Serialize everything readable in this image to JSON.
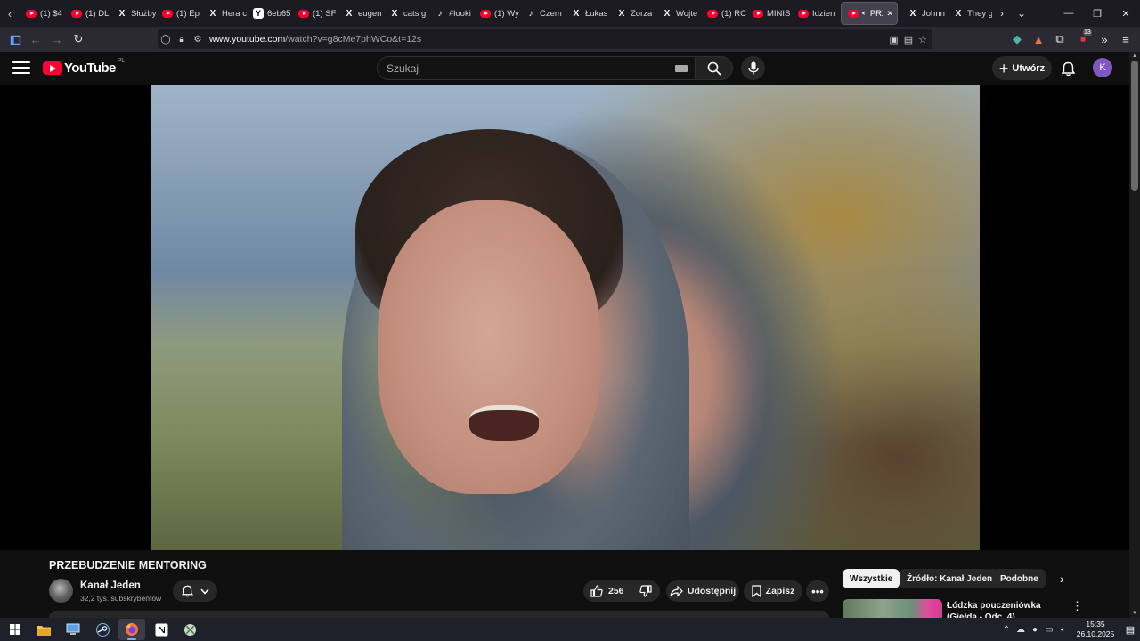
{
  "browser": {
    "tabs": [
      {
        "icon": "youtube-icon",
        "title": "(1) $4"
      },
      {
        "icon": "youtube-icon",
        "title": "(1) DL"
      },
      {
        "icon": "x-icon",
        "title": "Służby"
      },
      {
        "icon": "youtube-icon",
        "title": "(1) Ep"
      },
      {
        "icon": "x-icon",
        "title": "Hera c"
      },
      {
        "icon": "y-icon",
        "title": "6eb65"
      },
      {
        "icon": "youtube-icon",
        "title": "(1) SF"
      },
      {
        "icon": "x-icon",
        "title": "eugen"
      },
      {
        "icon": "x-icon",
        "title": "cats g"
      },
      {
        "icon": "tiktok-icon",
        "title": "#looki"
      },
      {
        "icon": "youtube-icon",
        "title": "(1) Wy"
      },
      {
        "icon": "tiktok-icon",
        "title": "Czem"
      },
      {
        "icon": "x-icon",
        "title": "Łukas"
      },
      {
        "icon": "x-icon",
        "title": "Zorza"
      },
      {
        "icon": "x-icon",
        "title": "Wojte"
      },
      {
        "icon": "youtube-icon",
        "title": "(1) RC"
      },
      {
        "icon": "youtube-icon",
        "title": "MINIS"
      },
      {
        "icon": "youtube-icon",
        "title": "Idzien"
      },
      {
        "icon": "youtube-icon",
        "title": "PRZ",
        "active": true
      },
      {
        "icon": "x-icon",
        "title": "Johnn"
      },
      {
        "icon": "x-icon",
        "title": "They g"
      }
    ],
    "url_host": "www.youtube.com",
    "url_path": "/watch?v=g8cMe7phWCo&t=12s",
    "extension_badge": "13"
  },
  "masthead": {
    "logo_text": "YouTube",
    "country_code": "PL",
    "search_placeholder": "Szukaj",
    "create_label": "Utwórz",
    "avatar_letter": "K"
  },
  "video": {
    "title": "PRZEBUDZENIE MENTORING",
    "channel_name": "Kanał Jeden",
    "subscribers": "32,2 tys. subskrybentów",
    "likes": "256",
    "share_label": "Udostępnij",
    "save_label": "Zapisz"
  },
  "sidebar": {
    "chips": [
      "Wszystkie",
      "Źródło: Kanał Jeden",
      "Podobne"
    ],
    "recommended": [
      {
        "title": "Łódzka pouczeniówka (Giełda - Odc. 4)"
      }
    ]
  },
  "taskbar": {
    "apps": [
      "windows-start-icon",
      "file-explorer-icon",
      "computer-icon",
      "steam-icon",
      "firefox-icon",
      "notion-icon",
      "xbox-icon"
    ],
    "time": "15:35",
    "date": "26.10.2025"
  },
  "colors": {
    "youtube_red": "#ff0033",
    "page_bg": "#0f0f0f",
    "avatar_bg": "#7e57c2"
  }
}
